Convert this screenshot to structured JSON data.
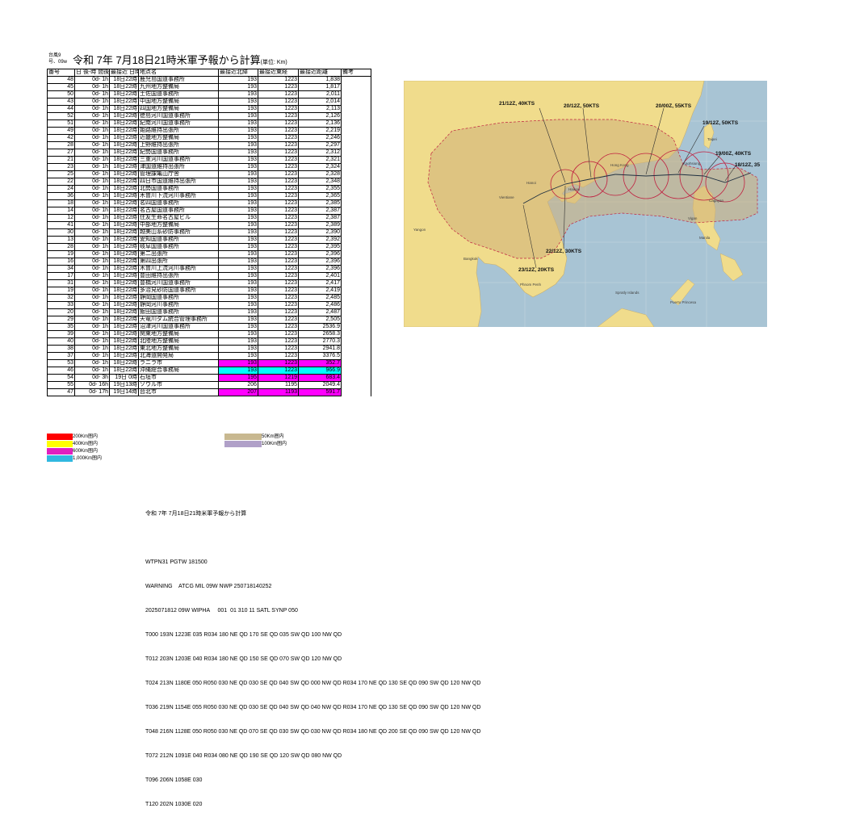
{
  "header": {
    "small_label_1": "台風9",
    "small_label_2": "号、09w",
    "title": "令和 7年 7月18日21時米軍予報から計算",
    "unit": "(単位: Km)"
  },
  "table": {
    "headers": [
      "番号",
      "日 後-時 間後",
      "最接近 日時",
      "地点名",
      "最接近北緯",
      "最接近東経",
      "最接近距離",
      "備考"
    ],
    "rows": [
      {
        "no": "48",
        "offset": "0d- 1h",
        "dt": "18日22時",
        "name": "鹿児島国道事務所",
        "lat": "193",
        "lon": "1223",
        "dist": "1,838",
        "hl": ""
      },
      {
        "no": "45",
        "offset": "0d- 1h",
        "dt": "18日22時",
        "name": "九州地方整備局",
        "lat": "193",
        "lon": "1223",
        "dist": "1,817",
        "hl": ""
      },
      {
        "no": "50",
        "offset": "0d- 1h",
        "dt": "18日22時",
        "name": "土佐国道事務所",
        "lat": "193",
        "lon": "1223",
        "dist": "2,011",
        "hl": ""
      },
      {
        "no": "43",
        "offset": "0d- 1h",
        "dt": "18日22時",
        "name": "中国地方整備局",
        "lat": "193",
        "lon": "1223",
        "dist": "2,014",
        "hl": ""
      },
      {
        "no": "44",
        "offset": "0d- 1h",
        "dt": "18日22時",
        "name": "四国地方整備局",
        "lat": "193",
        "lon": "1223",
        "dist": "2,113",
        "hl": ""
      },
      {
        "no": "52",
        "offset": "0d- 1h",
        "dt": "18日22時",
        "name": "徳島河川国道事務所",
        "lat": "193",
        "lon": "1223",
        "dist": "2,126",
        "hl": ""
      },
      {
        "no": "51",
        "offset": "0d- 1h",
        "dt": "18日22時",
        "name": "紀南河川国道事務所",
        "lat": "193",
        "lon": "1223",
        "dist": "2,136",
        "hl": ""
      },
      {
        "no": "49",
        "offset": "0d- 1h",
        "dt": "18日22時",
        "name": "姫路維持出張所",
        "lat": "193",
        "lon": "1223",
        "dist": "2,219",
        "hl": ""
      },
      {
        "no": "42",
        "offset": "0d- 1h",
        "dt": "18日22時",
        "name": "近畿地方整備局",
        "lat": "193",
        "lon": "1223",
        "dist": "2,246",
        "hl": ""
      },
      {
        "no": "28",
        "offset": "0d- 1h",
        "dt": "18日22時",
        "name": "上野維持出張所",
        "lat": "193",
        "lon": "1223",
        "dist": "2,297",
        "hl": ""
      },
      {
        "no": "27",
        "offset": "0d- 1h",
        "dt": "18日22時",
        "name": "紀勢国道事務所",
        "lat": "193",
        "lon": "1223",
        "dist": "2,312",
        "hl": ""
      },
      {
        "no": "21",
        "offset": "0d- 1h",
        "dt": "18日22時",
        "name": "三重河川国道事務所",
        "lat": "193",
        "lon": "1223",
        "dist": "2,321",
        "hl": ""
      },
      {
        "no": "23",
        "offset": "0d- 1h",
        "dt": "18日22時",
        "name": "津国道維持出張所",
        "lat": "193",
        "lon": "1223",
        "dist": "2,324",
        "hl": ""
      },
      {
        "no": "25",
        "offset": "0d- 1h",
        "dt": "18日22時",
        "name": "管理課亀山庁舎",
        "lat": "193",
        "lon": "1223",
        "dist": "2,328",
        "hl": ""
      },
      {
        "no": "22",
        "offset": "0d- 1h",
        "dt": "18日22時",
        "name": "四日市国道維持出張所",
        "lat": "193",
        "lon": "1223",
        "dist": "2,348",
        "hl": ""
      },
      {
        "no": "24",
        "offset": "0d- 1h",
        "dt": "18日22時",
        "name": "北勢国道事務所",
        "lat": "193",
        "lon": "1223",
        "dist": "2,355",
        "hl": ""
      },
      {
        "no": "36",
        "offset": "0d- 1h",
        "dt": "18日22時",
        "name": "木曽川下流河川事務所",
        "lat": "193",
        "lon": "1223",
        "dist": "2,365",
        "hl": ""
      },
      {
        "no": "18",
        "offset": "0d- 1h",
        "dt": "18日22時",
        "name": "名四国道事務所",
        "lat": "193",
        "lon": "1223",
        "dist": "2,385",
        "hl": ""
      },
      {
        "no": "14",
        "offset": "0d- 1h",
        "dt": "18日22時",
        "name": "名古屋国道事務所",
        "lat": "193",
        "lon": "1223",
        "dist": "2,387",
        "hl": ""
      },
      {
        "no": "12",
        "offset": "0d- 1h",
        "dt": "18日22時",
        "name": "住友生命名古屋ビル",
        "lat": "193",
        "lon": "1223",
        "dist": "2,387",
        "hl": ""
      },
      {
        "no": "41",
        "offset": "0d- 1h",
        "dt": "18日22時",
        "name": "中部地方整備局",
        "lat": "193",
        "lon": "1223",
        "dist": "2,389",
        "hl": ""
      },
      {
        "no": "30",
        "offset": "0d- 1h",
        "dt": "18日22時",
        "name": "越美山系砂防事務所",
        "lat": "193",
        "lon": "1223",
        "dist": "2,390",
        "hl": ""
      },
      {
        "no": "13",
        "offset": "0d- 1h",
        "dt": "18日22時",
        "name": "愛知国道事務所",
        "lat": "193",
        "lon": "1223",
        "dist": "2,392",
        "hl": ""
      },
      {
        "no": "28",
        "offset": "0d- 1h",
        "dt": "18日22時",
        "name": "岐阜国道事務所",
        "lat": "193",
        "lon": "1223",
        "dist": "2,395",
        "hl": ""
      },
      {
        "no": "19",
        "offset": "0d- 1h",
        "dt": "18日22時",
        "name": "第二出張所",
        "lat": "193",
        "lon": "1223",
        "dist": "2,396",
        "hl": ""
      },
      {
        "no": "16",
        "offset": "0d- 1h",
        "dt": "18日22時",
        "name": "第四出張所",
        "lat": "193",
        "lon": "1223",
        "dist": "2,396",
        "hl": ""
      },
      {
        "no": "34",
        "offset": "0d- 1h",
        "dt": "18日22時",
        "name": "木曽川上流河川事務所",
        "lat": "193",
        "lon": "1223",
        "dist": "2,396",
        "hl": ""
      },
      {
        "no": "17",
        "offset": "0d- 1h",
        "dt": "18日22時",
        "name": "豊田維持出張所",
        "lat": "193",
        "lon": "1223",
        "dist": "2,401",
        "hl": ""
      },
      {
        "no": "31",
        "offset": "0d- 1h",
        "dt": "18日22時",
        "name": "豊橋河川国道事務所",
        "lat": "193",
        "lon": "1223",
        "dist": "2,417",
        "hl": ""
      },
      {
        "no": "19",
        "offset": "0d- 1h",
        "dt": "18日22時",
        "name": "多治見砂防国道事務所",
        "lat": "193",
        "lon": "1223",
        "dist": "2,419",
        "hl": ""
      },
      {
        "no": "32",
        "offset": "0d- 1h",
        "dt": "18日22時",
        "name": "静岡国道事務所",
        "lat": "193",
        "lon": "1223",
        "dist": "2,485",
        "hl": ""
      },
      {
        "no": "33",
        "offset": "0d- 1h",
        "dt": "18日22時",
        "name": "静岡河川事務所",
        "lat": "193",
        "lon": "1223",
        "dist": "2,486",
        "hl": ""
      },
      {
        "no": "20",
        "offset": "0d- 1h",
        "dt": "18日22時",
        "name": "飯田国道事務所",
        "lat": "193",
        "lon": "1223",
        "dist": "2,487",
        "hl": ""
      },
      {
        "no": "29",
        "offset": "0d- 1h",
        "dt": "18日22時",
        "name": "天竜川ダム統合管理事務所",
        "lat": "193",
        "lon": "1223",
        "dist": "2,505",
        "hl": ""
      },
      {
        "no": "35",
        "offset": "0d- 1h",
        "dt": "18日22時",
        "name": "沼津河川国道事務所",
        "lat": "193",
        "lon": "1223",
        "dist": "2536.9",
        "hl": ""
      },
      {
        "no": "39",
        "offset": "0d- 1h",
        "dt": "18日22時",
        "name": "関東地方整備局",
        "lat": "193",
        "lon": "1223",
        "dist": "2658.3",
        "hl": ""
      },
      {
        "no": "40",
        "offset": "0d- 1h",
        "dt": "18日22時",
        "name": "北陸地方整備局",
        "lat": "193",
        "lon": "1223",
        "dist": "2770.3",
        "hl": ""
      },
      {
        "no": "38",
        "offset": "0d- 1h",
        "dt": "18日22時",
        "name": "東北地方整備局",
        "lat": "193",
        "lon": "1223",
        "dist": "2941.8",
        "hl": ""
      },
      {
        "no": "37",
        "offset": "0d- 1h",
        "dt": "18日22時",
        "name": "北海道開発局",
        "lat": "193",
        "lon": "1223",
        "dist": "3376.5",
        "hl": ""
      },
      {
        "no": "53",
        "offset": "0d- 1h",
        "dt": "18日22時",
        "name": "ラニラ市",
        "lat": "193",
        "lon": "1223",
        "dist": "352.7",
        "hl": "magenta"
      },
      {
        "no": "46",
        "offset": "0d- 1h",
        "dt": "18日22時",
        "name": "沖縄総合事務局",
        "lat": "193",
        "lon": "1223",
        "dist": "966.9",
        "hl": "cyan"
      },
      {
        "no": "54",
        "offset": "0d- 3h",
        "dt": "19日 0時",
        "name": "石垣市",
        "lat": "195",
        "lon": "1219",
        "dist": "683.4",
        "hl": "magenta"
      },
      {
        "no": "55",
        "offset": "0d- 16h",
        "dt": "19日13時",
        "name": "ソウル市",
        "lat": "206",
        "lon": "1195",
        "dist": "2049.4",
        "hl": ""
      },
      {
        "no": "47",
        "offset": "0d- 17h",
        "dt": "19日14時",
        "name": "台北市",
        "lat": "207",
        "lon": "1193",
        "dist": "591.7",
        "hl": "magenta"
      }
    ]
  },
  "legend": {
    "left": [
      {
        "label": "200Km圏内",
        "color": "#ff0000"
      },
      {
        "label": "400Km圏内",
        "color": "#ffff00"
      },
      {
        "label": "600Km圏内",
        "color": "#e020c0"
      },
      {
        "label": "1,000Km圏内",
        "color": "#30b8e0"
      }
    ],
    "right": [
      {
        "label": "50Km圏内",
        "color": "#c8b890"
      },
      {
        "label": "100Km圏内",
        "color": "#b0a0c8"
      }
    ]
  },
  "map": {
    "labels": {
      "l1": "21/12Z, 40KTS",
      "l2": "20/12Z, 50KTS",
      "l3": "20/00Z, 55KTS",
      "l4": "19/12Z, 50KTS",
      "l5": "19/00Z, 40KTS",
      "l6": "18/12Z, 35",
      "l7": "22/12Z, 30KTS",
      "l8": "23/12Z, 20KTS",
      "p1": "Hanoi",
      "p2": "Vientiane",
      "p3": "Yangon",
      "p4": "Bangkok",
      "p5": "Phnom Penh",
      "p6": "Spratly Islands",
      "p7": "Puerto Princesa",
      "p8": "Taipei",
      "p9": "Kaohsiung",
      "p10": "Manila",
      "p11": "Vigan",
      "p12": "Cagayan",
      "p13": "Hong Kong",
      "p14": "Haikou"
    },
    "colors": {
      "land": "#f0dc8c",
      "sea": "#a8c4d4",
      "danger": "#d0b078",
      "track": "#c02040"
    }
  },
  "message": {
    "heading": "令和 7年 7月18日21時米軍予報から計算",
    "lines": [
      "WTPN31 PGTW 181500",
      "WARNING    ATCG MIL 09W NWP 250718140252",
      "2025071812 09W WIPHA     001  01 310 11 SATL SYNP 050",
      "T000 193N 1223E 035 R034 180 NE QD 170 SE QD 035 SW QD 100 NW QD",
      "T012 203N 1203E 040 R034 180 NE QD 150 SE QD 070 SW QD 120 NW QD",
      "T024 213N 1180E 050 R050 030 NE QD 030 SE QD 040 SW QD 000 NW QD R034 170 NE QD 130 SE QD 090 SW QD 120 NW QD",
      "T036 219N 1154E 055 R050 030 NE QD 030 SE QD 040 SW QD 040 NW QD R034 170 NE QD 130 SE QD 090 SW QD 120 NW QD",
      "T048 216N 1128E 050 R050 030 NE QD 070 SE QD 030 SW QD 030 NW QD R034 180 NE QD 200 SE QD 090 SW QD 120 NW QD",
      "T072 212N 1091E 040 R034 080 NE QD 190 SE QD 120 SW QD 080 NW QD",
      "T096 206N 1058E 030",
      "T120 202N 1030E 020"
    ]
  }
}
